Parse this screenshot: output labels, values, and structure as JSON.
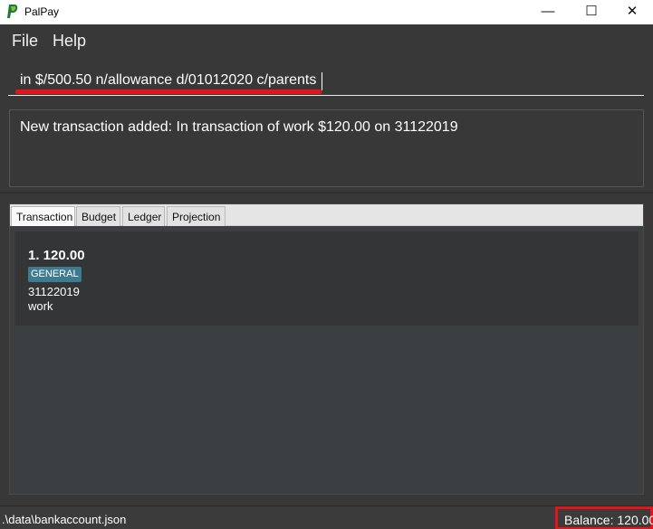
{
  "window": {
    "title": "PalPay",
    "minimize": "—",
    "maximize": "☐",
    "close": "✕"
  },
  "menu": {
    "file": "File",
    "help": "Help"
  },
  "command": {
    "value": "in $/500.50 n/allowance d/01012020 c/parents"
  },
  "result": {
    "text": "New transaction added: In transaction of work $120.00 on 31122019"
  },
  "tabs": [
    {
      "label": "Transaction"
    },
    {
      "label": "Budget"
    },
    {
      "label": "Ledger"
    },
    {
      "label": "Projection"
    }
  ],
  "transactions": [
    {
      "title": "1.  120.00",
      "tag": "GENERAL",
      "date": "31122019",
      "description": "work"
    }
  ],
  "status": {
    "path": ".\\data\\bankaccount.json",
    "balance": "Balance: 120.00"
  },
  "colors": {
    "highlight": "#e3141a",
    "tag": "#3e7b91",
    "background": "#383838"
  }
}
